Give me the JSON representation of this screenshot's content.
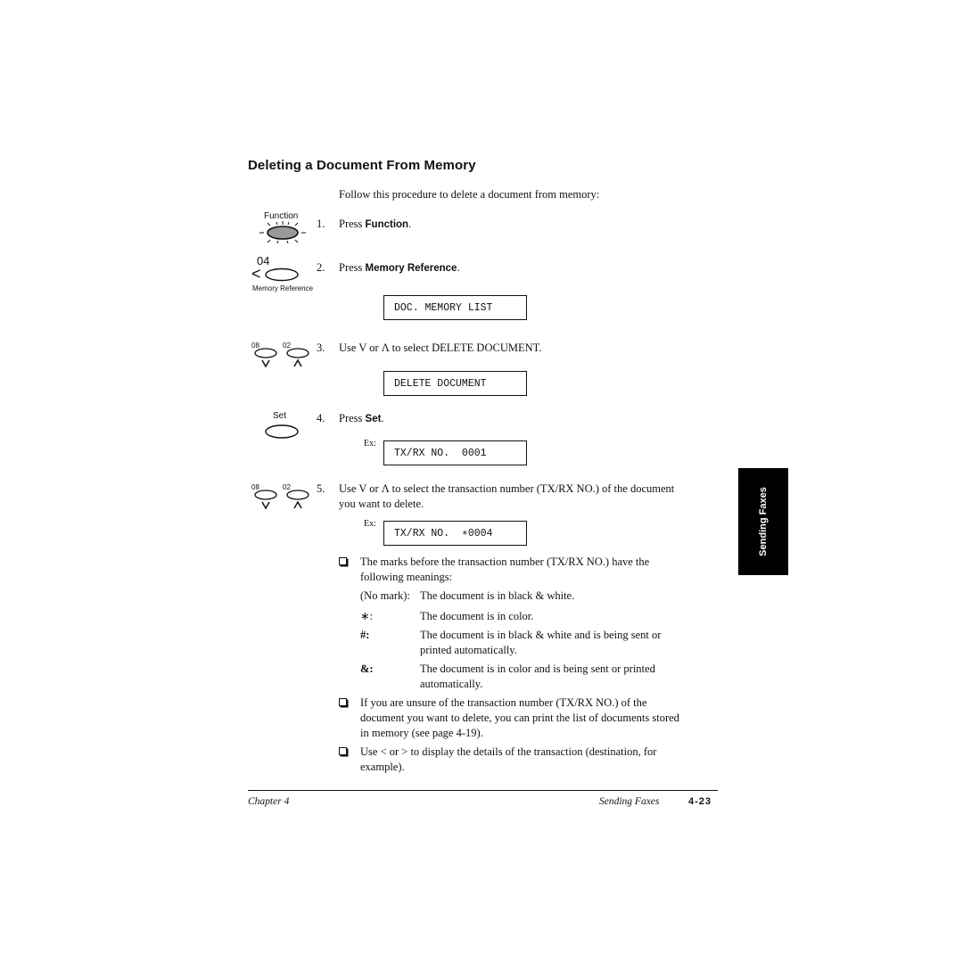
{
  "title": "Deleting a Document From Memory",
  "intro": "Follow this procedure to delete a document from memory:",
  "buttons": {
    "function_label": "Function",
    "memory_ref_code": "04",
    "memory_ref_label": "Memory Reference",
    "down_code": "08",
    "up_code": "02",
    "set_label": "Set",
    "down_arrow": "V",
    "up_arrow": "Λ",
    "left_arrow": "<"
  },
  "steps": [
    {
      "num": "1.",
      "prefix": "Press ",
      "bold": "Function",
      "suffix": "."
    },
    {
      "num": "2.",
      "prefix": "Press ",
      "bold": "Memory Reference",
      "suffix": "."
    },
    {
      "num": "3.",
      "text": "Use V or Λ to select DELETE DOCUMENT."
    },
    {
      "num": "4.",
      "prefix": "Press ",
      "bold": "Set",
      "suffix": "."
    },
    {
      "num": "5.",
      "line1": "Use V or Λ to select the transaction number (TX/RX NO.) of the document",
      "line2": "you want to delete."
    }
  ],
  "displays": {
    "doc_memory_list": "DOC. MEMORY LIST",
    "delete_document": "DELETE DOCUMENT",
    "txrx_0001": "TX/RX NO.  0001",
    "txrx_0004": "TX/RX NO.  ∗0004",
    "ex_label": "Ex:"
  },
  "notes": {
    "marks_intro_1": "The marks before the transaction number (TX/RX NO.) have the",
    "marks_intro_2": "following meanings:",
    "marks": [
      {
        "mark": "(No mark):",
        "line1": "The document is in black & white.",
        "line2": ""
      },
      {
        "mark": "∗:",
        "line1": "The document is in color.",
        "line2": ""
      },
      {
        "mark": "#:",
        "line1": "The document is in black & white and is being sent or",
        "line2": "printed automatically."
      },
      {
        "mark": "&:",
        "line1": "The document is in color and is being sent or printed",
        "line2": "automatically."
      }
    ],
    "unsure_1": "If you are unsure of the transaction number (TX/RX NO.) of the",
    "unsure_2": "document you want to delete, you can print the list of documents stored",
    "unsure_3": "in memory (see page 4-19).",
    "details_1": "Use < or > to display the details of the transaction (destination, for",
    "details_2": "example)."
  },
  "side_tab": "Sending Faxes",
  "footer": {
    "chapter": "Chapter 4",
    "section": "Sending Faxes",
    "page": "4-23"
  }
}
